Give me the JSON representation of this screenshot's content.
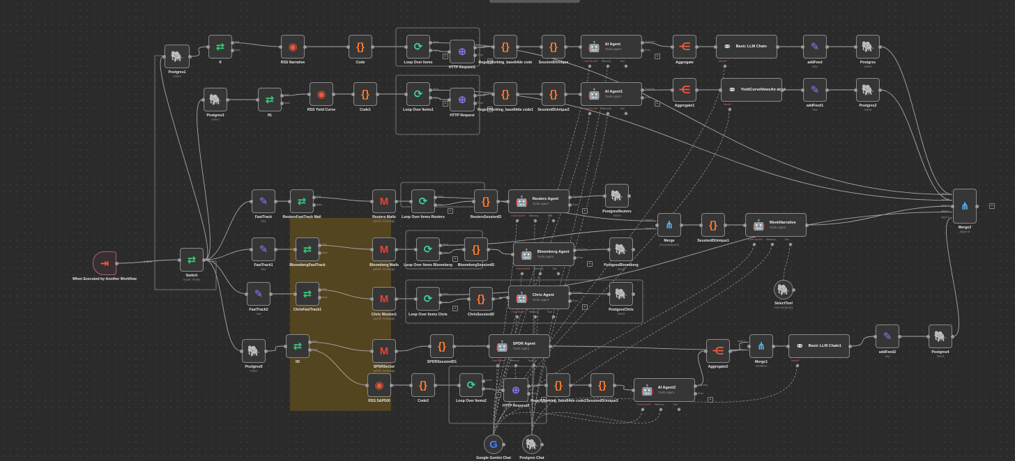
{
  "colors": {
    "canvas": "#2b2b2b",
    "node": "#363636",
    "border": "#8a8a8a",
    "sticky": "#584821",
    "wire": "#a8a8a8"
  },
  "edge_label": "1 item",
  "nodes": [
    {
      "id": "postgres1",
      "title": "Postgres1",
      "sub": "select",
      "icon": "postgres"
    },
    {
      "id": "if",
      "title": "If",
      "sub": "",
      "icon": "if",
      "outs": [
        "true",
        "false"
      ]
    },
    {
      "id": "rssNarrative",
      "title": "RSS Narrative",
      "sub": "",
      "icon": "rss"
    },
    {
      "id": "code",
      "title": "Code",
      "sub": "",
      "icon": "code"
    },
    {
      "id": "loop1",
      "title": "Loop Over Items",
      "sub": "",
      "icon": "loop",
      "outs": [
        "done",
        "loop"
      ]
    },
    {
      "id": "http1",
      "title": "HTTP Request1",
      "sub": "",
      "icon": "http",
      "outs": [
        "Success",
        "Error"
      ]
    },
    {
      "id": "regex1",
      "title": "RegeXWorking_base64de code",
      "sub": "",
      "icon": "code"
    },
    {
      "id": "session1",
      "title": "SessionIDUnique",
      "sub": "",
      "icon": "code"
    },
    {
      "id": "aiAgent",
      "title": "AI Agent",
      "sub": "Tools Agent",
      "icon": "robot",
      "wide": true,
      "outs": [
        "Success",
        "Error"
      ],
      "bottom": [
        "Chat Model*",
        "Memory",
        "Tool"
      ]
    },
    {
      "id": "aggregate",
      "title": "Aggregate",
      "sub": "",
      "icon": "aggregate"
    },
    {
      "id": "basicLLM",
      "title": "Basic LLM Chain",
      "sub": "",
      "icon": "link",
      "wide": true,
      "bottom": [
        "Model*"
      ]
    },
    {
      "id": "addFeed",
      "title": "addFeed",
      "sub": "raw",
      "icon": "pen"
    },
    {
      "id": "postgres",
      "title": "Postgres",
      "sub": "insert",
      "icon": "postgres"
    },
    {
      "id": "postgres3",
      "title": "Postgres3",
      "sub": "select",
      "icon": "postgres"
    },
    {
      "id": "if1",
      "title": "If1",
      "sub": "",
      "icon": "if",
      "outs": [
        "true",
        "false"
      ]
    },
    {
      "id": "rssYield",
      "title": "RSS Yield Curve",
      "sub": "",
      "icon": "rss"
    },
    {
      "id": "code1",
      "title": "Code1",
      "sub": "",
      "icon": "code"
    },
    {
      "id": "loop2",
      "title": "Loop Over Items1",
      "sub": "",
      "icon": "loop",
      "outs": [
        "done",
        "loop"
      ]
    },
    {
      "id": "http2",
      "title": "HTTP Request",
      "sub": "",
      "icon": "http",
      "outs": [
        "Success",
        "Error"
      ]
    },
    {
      "id": "regex2",
      "title": "RegeXWorking_base64de code1",
      "sub": "",
      "icon": "code"
    },
    {
      "id": "session2",
      "title": "SessionIDUnique2",
      "sub": "",
      "icon": "code"
    },
    {
      "id": "aiAgent1",
      "title": "AI Agent1",
      "sub": "Tools Agent",
      "icon": "robot",
      "wide": true,
      "outs": [
        "Success",
        "Error"
      ],
      "bottom": [
        "Chat Model*",
        "Memory",
        "Tool"
      ]
    },
    {
      "id": "aggregate1",
      "title": "Aggregate1",
      "sub": "",
      "icon": "aggregate"
    },
    {
      "id": "yieldAnalyst",
      "title": "YieldCurveNewsAn alyst",
      "sub": "",
      "icon": "link",
      "wide": true,
      "bottom": [
        "Model*"
      ]
    },
    {
      "id": "addFeed1",
      "title": "addFeed1",
      "sub": "raw",
      "icon": "pen"
    },
    {
      "id": "postgres2",
      "title": "Postgres2",
      "sub": "insert",
      "icon": "postgres"
    },
    {
      "id": "merge2",
      "title": "Merge2",
      "sub": "append",
      "icon": "merge",
      "ins": [
        "Input 1",
        "Input 2",
        "Input 3",
        "Input 4",
        "Input 5"
      ]
    },
    {
      "id": "fastTrack",
      "title": "FastTrack",
      "sub": "raw",
      "icon": "pen"
    },
    {
      "id": "reutersFT",
      "title": "ReutersFastTrack Mail",
      "sub": "",
      "icon": "if",
      "outs": [
        "true",
        "false"
      ]
    },
    {
      "id": "reutersMails",
      "title": "Reuters Mails",
      "sub": "getAll: message",
      "icon": "gmail"
    },
    {
      "id": "loopReuters",
      "title": "Loop Over Items Reuters",
      "sub": "",
      "icon": "loop",
      "outs": [
        "done",
        "loop"
      ]
    },
    {
      "id": "reutersSession",
      "title": "ReutersSessionID",
      "sub": "",
      "icon": "code"
    },
    {
      "id": "reutersAgent",
      "title": "Reuters Agent",
      "sub": "Tools Agent",
      "icon": "robot",
      "wide": true,
      "outs": [
        "Success",
        "Error"
      ],
      "bottom": [
        "Chat Model*",
        "Memory",
        "Tool"
      ]
    },
    {
      "id": "pgReuters",
      "title": "PostgresReuters",
      "sub": "insert",
      "icon": "postgres"
    },
    {
      "id": "merge",
      "title": "Merge",
      "sub": "chooseBranch",
      "icon": "merge",
      "ins": [
        "Input 1",
        "Input 2"
      ]
    },
    {
      "id": "sessionU1",
      "title": "SessionIDUnique1",
      "sub": "",
      "icon": "code"
    },
    {
      "id": "weekNarr",
      "title": "WeekNarrative",
      "sub": "Tools Agent",
      "icon": "robot",
      "wide": true,
      "bottom": [
        "Chat Model*",
        "Memory",
        "Tool"
      ]
    },
    {
      "id": "trigger",
      "title": "When Executed by Another Workflow",
      "sub": "",
      "icon": "trigger"
    },
    {
      "id": "switch",
      "title": "Switch",
      "sub": "mode: Rules",
      "icon": "if"
    },
    {
      "id": "fastTrack1",
      "title": "FastTrack1",
      "sub": "raw",
      "icon": "pen"
    },
    {
      "id": "bloombergFT",
      "title": "BloombergFastTrack",
      "sub": "",
      "icon": "if",
      "outs": [
        "true",
        "false"
      ]
    },
    {
      "id": "bloombergMails",
      "title": "Bloomberg Mails",
      "sub": "getAll: message",
      "icon": "gmail"
    },
    {
      "id": "loopBloomberg",
      "title": "Loop Over Items Bloomberg",
      "sub": "",
      "icon": "loop",
      "outs": [
        "done",
        "loop"
      ]
    },
    {
      "id": "bloombergSession",
      "title": "BloombergSessionID",
      "sub": "",
      "icon": "code"
    },
    {
      "id": "bloombergAgent",
      "title": "Bloomberg Agent",
      "sub": "Tools Agent",
      "icon": "robot",
      "wide": true,
      "outs": [
        "Success",
        "Error"
      ],
      "bottom": [
        "Chat Model*",
        "Memory",
        "Tool"
      ]
    },
    {
      "id": "pgBloomberg",
      "title": "PostgresBloomberg",
      "sub": "insert",
      "icon": "postgres"
    },
    {
      "id": "selectTool",
      "title": "SelectTool",
      "sub": "executeQuery",
      "icon": "postgres",
      "round": true
    },
    {
      "id": "fastTrack2",
      "title": "FastTrack2",
      "sub": "raw",
      "icon": "pen"
    },
    {
      "id": "chrisFT",
      "title": "ChrisFastTrack1",
      "sub": "",
      "icon": "if",
      "outs": [
        "true",
        "false"
      ]
    },
    {
      "id": "chrisWeston",
      "title": "Chris Weston1",
      "sub": "getAll: message",
      "icon": "gmail"
    },
    {
      "id": "loopChris",
      "title": "Loop Over Items Chris",
      "sub": "",
      "icon": "loop",
      "outs": [
        "done",
        "loop"
      ]
    },
    {
      "id": "chrisSession",
      "title": "ChrisSessionID",
      "sub": "",
      "icon": "code"
    },
    {
      "id": "chrisAgent",
      "title": "Chris Agent",
      "sub": "Tools Agent",
      "icon": "robot",
      "wide": true,
      "outs": [
        "Success",
        "Error"
      ],
      "bottom": [
        "Chat Model*",
        "Memory",
        "Tool"
      ]
    },
    {
      "id": "pgChris",
      "title": "PostgresChris",
      "sub": "insert",
      "icon": "postgres"
    },
    {
      "id": "postgres5",
      "title": "Postgres5",
      "sub": "select",
      "icon": "postgres"
    },
    {
      "id": "if2",
      "title": "If2",
      "sub": "",
      "icon": "if",
      "outs": [
        "true",
        "false"
      ]
    },
    {
      "id": "spdrSector",
      "title": "SPDRSector",
      "sub": "getAll: message",
      "icon": "gmail"
    },
    {
      "id": "spdrSession",
      "title": "SPDRSessionID1",
      "sub": "",
      "icon": "code"
    },
    {
      "id": "spdrAgent",
      "title": "SPDR Agent",
      "sub": "Tools Agent",
      "icon": "robot",
      "wide": true,
      "bottom": [
        "Chat Model*",
        "Memory",
        "Tool"
      ]
    },
    {
      "id": "aggregate2",
      "title": "Aggregate2",
      "sub": "",
      "icon": "aggregate"
    },
    {
      "id": "merge1",
      "title": "Merge1",
      "sub": "combine",
      "icon": "merge",
      "ins": [
        "Input 1",
        "Input 2"
      ]
    },
    {
      "id": "basicLLM1",
      "title": "Basic LLM Chain1",
      "sub": "",
      "icon": "link",
      "wide": true,
      "bottom": [
        "Model*"
      ]
    },
    {
      "id": "addFeed2",
      "title": "addFeed2",
      "sub": "raw",
      "icon": "pen"
    },
    {
      "id": "postgres4",
      "title": "Postgres4",
      "sub": "insert",
      "icon": "postgres"
    },
    {
      "id": "rssSP500",
      "title": "RSS S&P500",
      "sub": "",
      "icon": "rss"
    },
    {
      "id": "code2",
      "title": "Code2",
      "sub": "",
      "icon": "code"
    },
    {
      "id": "loop3",
      "title": "Loop Over Items2",
      "sub": "",
      "icon": "loop",
      "outs": [
        "done",
        "loop"
      ]
    },
    {
      "id": "http3",
      "title": "HTTP Request2",
      "sub": "",
      "icon": "http",
      "outs": [
        "Success",
        "Error"
      ]
    },
    {
      "id": "regex3",
      "title": "RegeXWorking_base64de code2",
      "sub": "",
      "icon": "code"
    },
    {
      "id": "session3",
      "title": "SessionIDUnique3",
      "sub": "",
      "icon": "code"
    },
    {
      "id": "aiAgent2",
      "title": "AI Agent2",
      "sub": "Tools Agent",
      "icon": "robot",
      "wide": true,
      "outs": [
        "Success",
        "Error"
      ],
      "bottom": [
        "Chat Model*",
        "Memory",
        "Tool"
      ]
    },
    {
      "id": "gemini",
      "title": "Google Gemini Chat",
      "sub": "",
      "icon": "google",
      "round": true
    },
    {
      "id": "pgChat",
      "title": "Postgres Chat",
      "sub": "",
      "icon": "postgres",
      "round": true
    }
  ]
}
